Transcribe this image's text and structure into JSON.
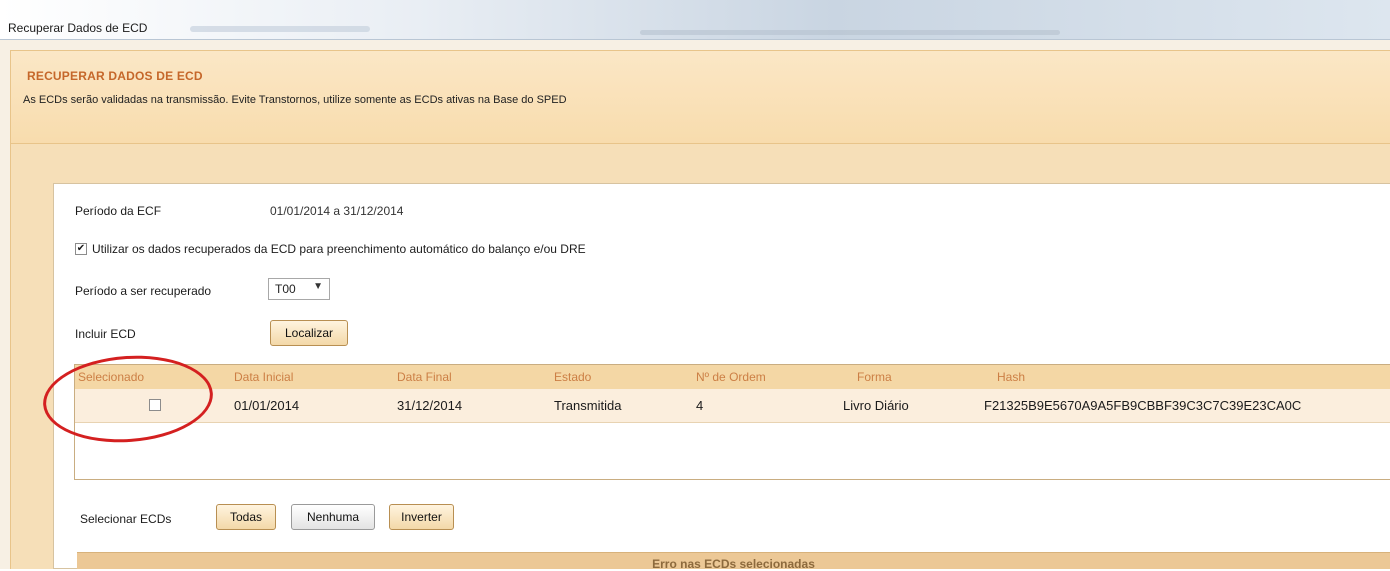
{
  "window": {
    "title": "Recuperar Dados de ECD"
  },
  "header": {
    "title": "RECUPERAR DADOS DE ECD",
    "subtitle": "As ECDs serão validadas na transmissão. Evite Transtornos, utilize somente as ECDs ativas na Base do SPED"
  },
  "form": {
    "periodo_ecf_label": "Período da ECF",
    "periodo_ecf_value": "01/01/2014 a 31/12/2014",
    "checkbox_label": "Utilizar os dados recuperados da ECD para preenchimento automático do balanço e/ou DRE",
    "checkbox_checked": true,
    "periodo_recuperado_label": "Período a ser recuperado",
    "periodo_recuperado_value": "T00",
    "incluir_ecd_label": "Incluir ECD",
    "localizar_button": "Localizar"
  },
  "grid": {
    "columns": [
      "Selecionado",
      "Data Inicial",
      "Data Final",
      "Estado",
      "Nº de Ordem",
      "Forma",
      "Hash"
    ],
    "rows": [
      {
        "selecionado": false,
        "data_inicial": "01/01/2014",
        "data_final": "31/12/2014",
        "estado": "Transmitida",
        "ordem": "4",
        "forma": "Livro Diário",
        "hash": "F21325B9E5670A9A5FB9CBBF39C3C7C39E23CA0C"
      }
    ]
  },
  "selection": {
    "label": "Selecionar ECDs",
    "todas": "Todas",
    "nenhuma": "Nenhuma",
    "inverter": "Inverter"
  },
  "error_bar": {
    "title": "Erro nas ECDs selecionadas"
  },
  "colors": {
    "accent": "#c5672a",
    "header_bg": "#f8dcad",
    "grid_header": "#f4d7a5",
    "annotation": "#d42020"
  }
}
